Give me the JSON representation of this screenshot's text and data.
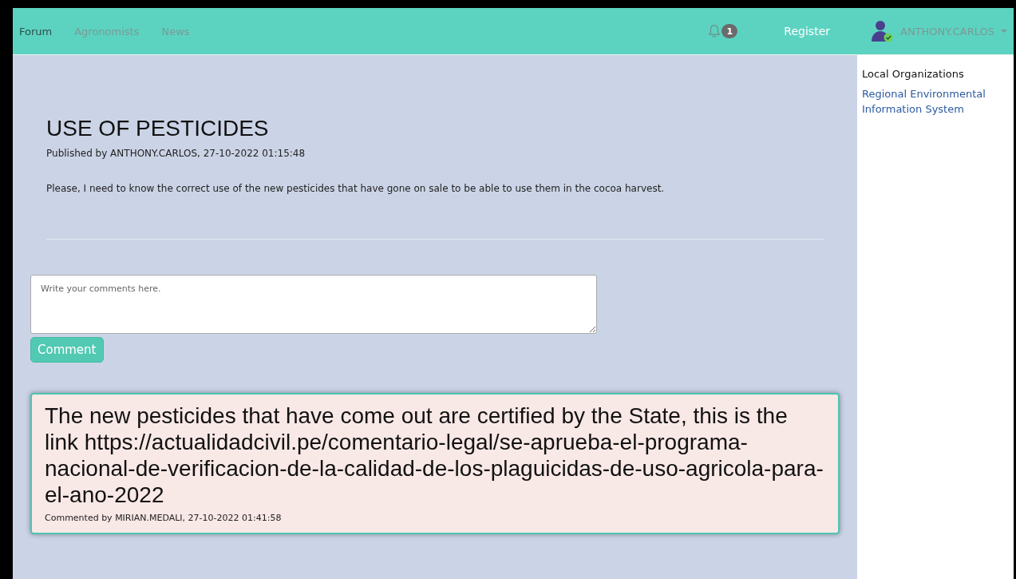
{
  "navbar": {
    "items": [
      {
        "label": "Forum",
        "selected": true
      },
      {
        "label": "Agronomists",
        "selected": false
      },
      {
        "label": "News",
        "selected": false
      }
    ],
    "notifications": {
      "count": "1"
    },
    "register": "Register",
    "user": {
      "name": "ANTHONY.CARLOS",
      "online": true
    }
  },
  "post": {
    "title": "USE OF PESTICIDES",
    "meta": "Published by ANTHONY.CARLOS, 27-10-2022 01:15:48",
    "body": "Please, I need to know the correct use of the new pesticides that have gone on sale to be able to use them in the cocoa harvest."
  },
  "comment_form": {
    "placeholder": "Write your comments here.",
    "button": "Comment"
  },
  "comments": [
    {
      "text": "The new pesticides that have come out are certified by the State, this is the link https://actualidadcivil.pe/comentario-legal/se-aprueba-el-programa-nacional-de-verificacion-de-la-calidad-de-los-plaguicidas-de-uso-agricola-para-el-ano-2022",
      "meta": "Commented by MIRIAN.MEDALI, 27-10-2022 01:41:58"
    }
  ],
  "sidebar": {
    "heading": "Local Organizations",
    "links": [
      "Regional Environmental Information System"
    ]
  }
}
